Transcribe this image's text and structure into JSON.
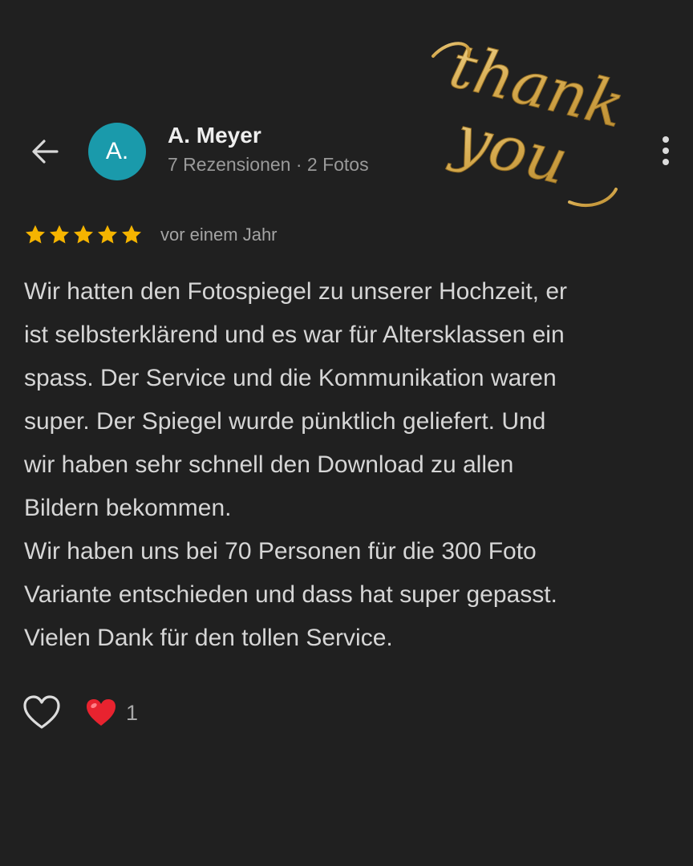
{
  "header": {
    "reviewer_name": "A. Meyer",
    "avatar_initials": "A.",
    "reviewer_meta": "7 Rezensionen · 2 Fotos",
    "back_icon": "arrow-left-icon",
    "more_icon": "more-vertical-icon"
  },
  "sticker": {
    "text": "thank you",
    "color": "#d9b45c"
  },
  "review": {
    "rating": 5,
    "rating_max": 5,
    "date": "vor einem Jahr",
    "lines": [
      "Wir hatten den Fotospiegel zu unserer Hochzeit, er",
      "ist selbsterklärend und es war für Altersklassen ein",
      "spass. Der Service und die Kommunikation waren",
      "super. Der Spiegel wurde pünktlich geliefert. Und",
      "wir haben sehr schnell den Download zu allen",
      "Bildern bekommen.",
      "Wir haben uns bei 70 Personen für die 300 Foto",
      "Variante entschieden und dass hat super gepasst.",
      "Vielen Dank für den tollen Service."
    ]
  },
  "reactions": {
    "like_icon": "heart-outline-icon",
    "reaction_icon": "red-heart-icon",
    "count": "1"
  },
  "colors": {
    "background": "#202020",
    "avatar": "#1a9aab",
    "star": "#f5b400",
    "heart": "#e8232f",
    "sticker_gold": "#d9b45c"
  }
}
